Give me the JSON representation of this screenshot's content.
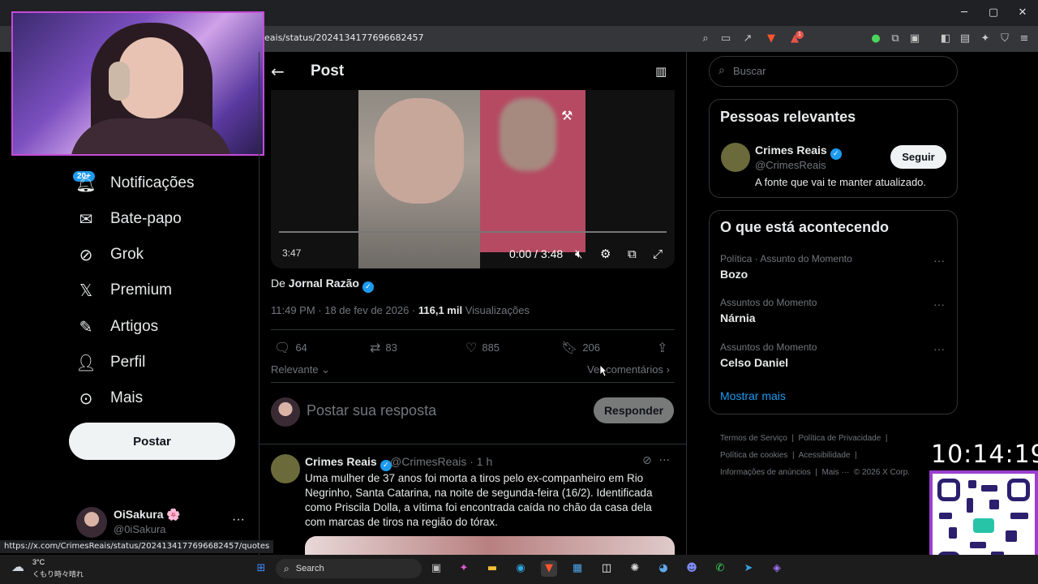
{
  "browser": {
    "url": "eais/status/2024134177696682457",
    "status_url": "https://x.com/CrimesReais/status/2024134177696682457/quotes",
    "ext_badge": "1"
  },
  "nav": {
    "notif_badge": "20+",
    "items": [
      {
        "label": "Notificações",
        "icon": "bell-icon"
      },
      {
        "label": "Bate-papo",
        "icon": "mail-icon"
      },
      {
        "label": "Grok",
        "icon": "grok-icon"
      },
      {
        "label": "Premium",
        "icon": "x-logo-icon"
      },
      {
        "label": "Artigos",
        "icon": "article-icon"
      },
      {
        "label": "Perfil",
        "icon": "person-icon"
      },
      {
        "label": "Mais",
        "icon": "more-circle-icon"
      }
    ],
    "post_button": "Postar",
    "account": {
      "name": "OiSakura 🌸",
      "handle": "@0iSakura"
    }
  },
  "main": {
    "title": "Post",
    "video": {
      "time_left": "3:47",
      "time": "0:00 / 3:48"
    },
    "from_prefix": "De ",
    "from_name": "Jornal Razão",
    "meta": {
      "time": "11:49 PM · 18 de fev de 2026 · ",
      "views_count": "116,1 mil",
      "views_label": " Visualizações"
    },
    "actions": {
      "replies": "64",
      "reposts": "83",
      "likes": "885",
      "bookmarks": "206"
    },
    "sort_label": "Relevante",
    "see_comments": "Ver comentários",
    "reply_placeholder": "Postar sua resposta",
    "reply_button": "Responder",
    "tweet": {
      "name": "Crimes Reais",
      "handle_time": "@CrimesReais · 1 h",
      "text": "Uma mulher de 37 anos foi morta a tiros pelo ex-companheiro em Rio Negrinho, Santa Catarina, na noite de segunda-feira (16/2). Identificada como Priscila Dolla, a vítima foi encontrada caída no chão da casa dela com marcas de tiros na região do tórax."
    }
  },
  "sidebar": {
    "search_placeholder": "Buscar",
    "people": {
      "title": "Pessoas relevantes",
      "name": "Crimes Reais",
      "handle": "@CrimesReais",
      "bio": "A fonte que vai te manter atualizado.",
      "follow": "Seguir"
    },
    "trends": {
      "title": "O que está acontecendo",
      "items": [
        {
          "context": "Política · Assunto do Momento",
          "name": "Bozo"
        },
        {
          "context": "Assuntos do Momento",
          "name": "Nárnia"
        },
        {
          "context": "Assuntos do Momento",
          "name": "Celso Daniel"
        }
      ],
      "show_more": "Mostrar mais"
    },
    "footer": [
      "Termos de Serviço",
      "Política de Privacidade",
      "Política de cookies",
      "Acessibilidade",
      "Informações de anúncios",
      "Mais ···",
      "© 2026 X Corp."
    ]
  },
  "overlay": {
    "clock": "10:14:19"
  },
  "taskbar": {
    "weather_temp": "3°C",
    "weather_desc": "くもり時々晴れ",
    "search_label": "Search"
  },
  "colors": {
    "accent": "#1d9bf0",
    "background": "#000000",
    "webcam_border": "#c64bd8"
  }
}
